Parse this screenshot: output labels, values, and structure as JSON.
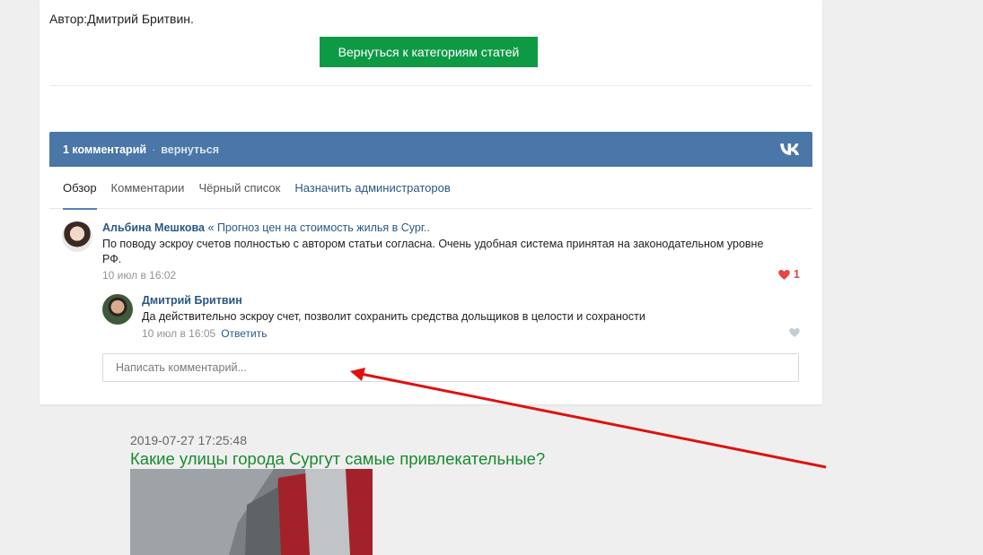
{
  "article": {
    "author": "Автор:Дмитрий Бритвин.",
    "back_button": "Вернуться к категориям статей"
  },
  "widget": {
    "count": "1 комментарий",
    "dot": "·",
    "back_link": "вернуться",
    "tabs": [
      {
        "label": "Обзор"
      },
      {
        "label": "Комментарии"
      },
      {
        "label": "Чёрный список"
      },
      {
        "label": "Назначить администраторов"
      }
    ]
  },
  "comments": [
    {
      "author": "Альбина Мешкова",
      "separator": "«",
      "topic": "Прогноз цен на стоимость жилья в Сург..",
      "text": "По поводу эскроу счетов полностью с автором статьи согласна. Очень удобная система принятая на законодательном уровне РФ.",
      "time": "10 июл в 16:02",
      "likes": "1"
    },
    {
      "author": "Дмитрий Бритвин",
      "text": "Да действительно эскроу счет, позволит сохранить средства дольщиков в целости и сохраности",
      "time": "10 июл в 16:05",
      "reply": "Ответить"
    }
  ],
  "input": {
    "placeholder": "Написать комментарий..."
  },
  "post": {
    "date": "2019-07-27 17:25:48",
    "title": "Какие улицы города Сургут самые привлекательные?"
  },
  "colors": {
    "vk_blue": "#4a76a8",
    "green_button": "#0e9a45",
    "link": "#2a5885",
    "heart": "#e64646",
    "post_title": "#1a8a2e",
    "arrow": "#e01010"
  }
}
